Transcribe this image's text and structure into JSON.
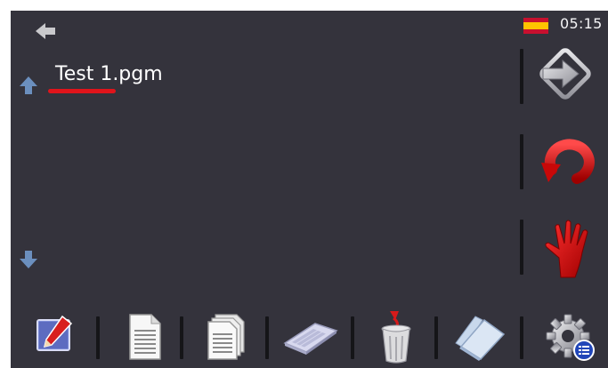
{
  "status": {
    "time": "05:15",
    "language_flag_icon": "spain-flag-icon"
  },
  "file_list": {
    "items": [
      {
        "label": "Test 1.pgm",
        "selected": true
      }
    ],
    "selection_color": "#e0141b"
  },
  "navigation": {
    "back_icon": "back-arrow-icon",
    "scroll_up_icon": "arrow-up-icon",
    "scroll_down_icon": "arrow-down-icon"
  },
  "side_actions": [
    {
      "name": "enter-button",
      "icon": "enter-arrow-icon"
    },
    {
      "name": "reset-button",
      "icon": "red-circular-arrow-icon"
    },
    {
      "name": "stop-button",
      "icon": "red-hand-icon"
    }
  ],
  "toolbar": [
    {
      "name": "edit-button",
      "icon": "pencil-edit-icon"
    },
    {
      "name": "new-file-button",
      "icon": "document-icon"
    },
    {
      "name": "copy-button",
      "icon": "documents-copy-icon"
    },
    {
      "name": "rename-button",
      "icon": "keyboard-icon"
    },
    {
      "name": "delete-button",
      "icon": "trash-icon"
    },
    {
      "name": "folder-button",
      "icon": "folder-icon"
    },
    {
      "name": "settings-button",
      "icon": "gear-icon"
    }
  ],
  "colors": {
    "background": "#34333c",
    "separator": "#151518",
    "arrow_blue": "#6b8fbe"
  }
}
